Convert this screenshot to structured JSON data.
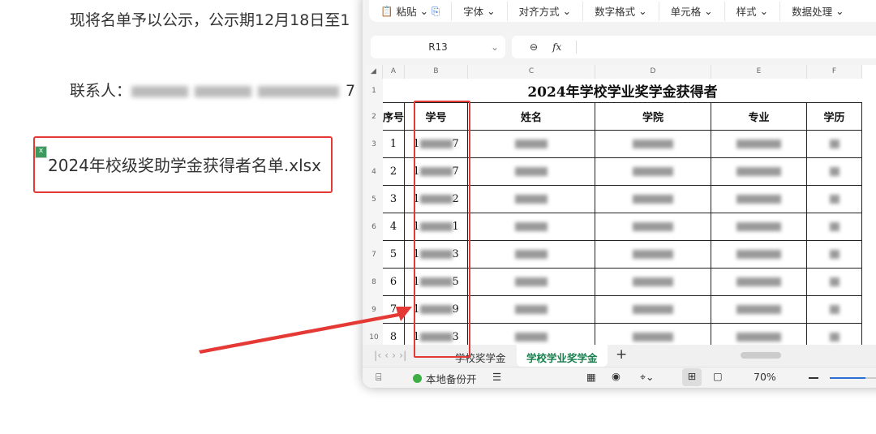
{
  "doc": {
    "line1": "现将名单予以公示，公示期12月18日至1",
    "contact_label": "联系人：",
    "contact_tail": "7",
    "file_name": "2024年校级奖助学金获得者名单.xlsx"
  },
  "ribbon": [
    "粘贴",
    "字体",
    "对齐方式",
    "数字格式",
    "单元格",
    "样式",
    "数据处理"
  ],
  "formula": {
    "cell_ref": "R13",
    "fx": "fx",
    "value": ""
  },
  "columns": [
    "A",
    "B",
    "C",
    "D",
    "E",
    "F"
  ],
  "sheet": {
    "title": "2024年学校学业奖学金获得者",
    "headers": [
      "序号",
      "学号",
      "姓名",
      "学院",
      "专业",
      "学历"
    ],
    "rows": [
      {
        "n": "1",
        "id_first": "1",
        "id_last": "7"
      },
      {
        "n": "2",
        "id_first": "1",
        "id_last": "7"
      },
      {
        "n": "3",
        "id_first": "1",
        "id_last": "2"
      },
      {
        "n": "4",
        "id_first": "1",
        "id_last": "1"
      },
      {
        "n": "5",
        "id_first": "1",
        "id_last": "3"
      },
      {
        "n": "6",
        "id_first": "1",
        "id_last": "5"
      },
      {
        "n": "7",
        "id_first": "1",
        "id_last": "9"
      },
      {
        "n": "8",
        "id_first": "1",
        "id_last": "3"
      }
    ],
    "row_numbers": [
      "1",
      "2",
      "3",
      "4",
      "5",
      "6",
      "7",
      "8",
      "9",
      "10"
    ]
  },
  "tabs": [
    "学校奖学金",
    "学校学业奖学金"
  ],
  "active_tab_color": "#1a7f4e",
  "status": {
    "backup": "本地备份开",
    "zoom": "70%",
    "zoom_fraction": 0.6
  }
}
